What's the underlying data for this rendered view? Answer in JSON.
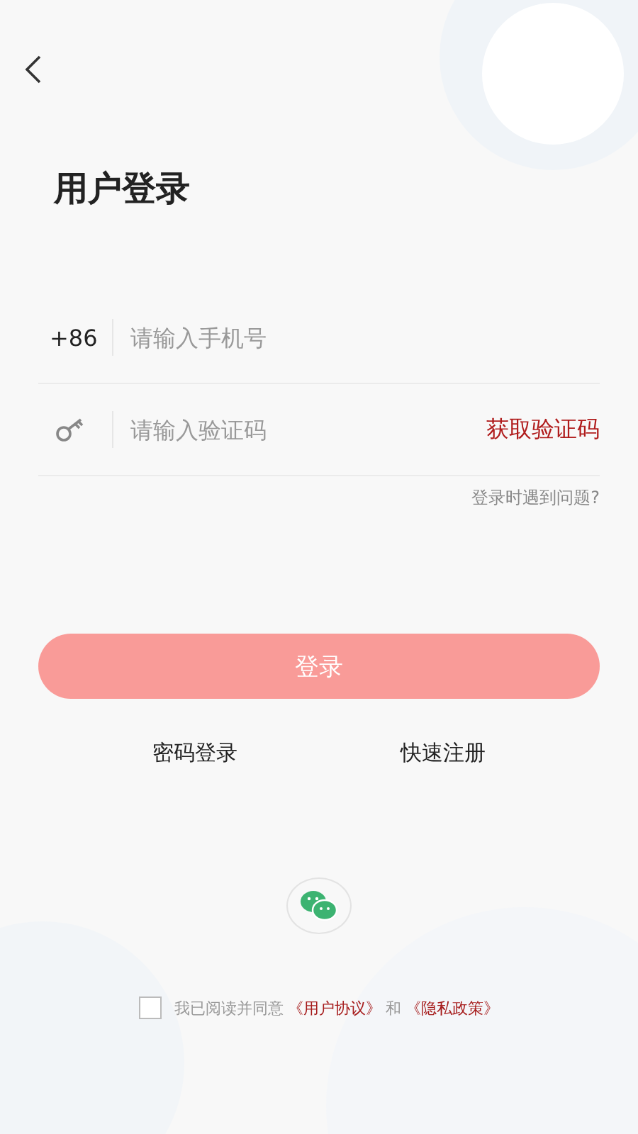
{
  "title": "用户登录",
  "phone_field": {
    "prefix": "+86",
    "placeholder": "请输入手机号"
  },
  "code_field": {
    "placeholder": "请输入验证码",
    "action": "获取验证码"
  },
  "help_link": "登录时遇到问题?",
  "login_button": {
    "label": "登录",
    "disabled": true
  },
  "links": [
    "密码登录",
    "快速注册"
  ],
  "agreement": {
    "checked": false,
    "text": "我已阅读并同意",
    "terms": "《用户协议》",
    "and": "和",
    "privacy": "《隐私政策》"
  }
}
